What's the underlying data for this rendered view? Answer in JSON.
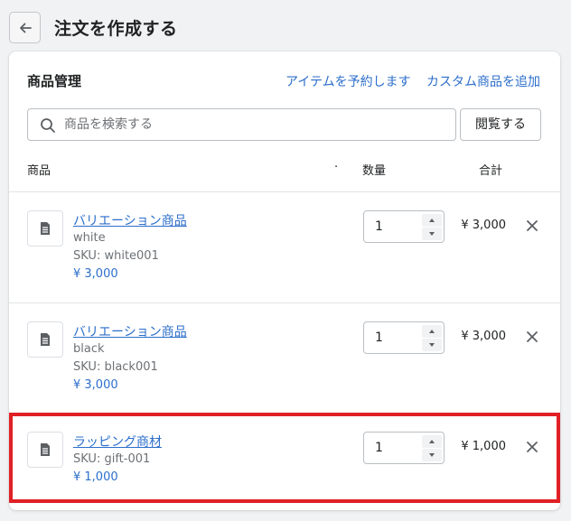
{
  "header": {
    "title": "注文を作成する"
  },
  "section": {
    "title": "商品管理",
    "reserve_link": "アイテムを予約します",
    "custom_link": "カスタム商品を追加"
  },
  "search": {
    "placeholder": "商品を検索する",
    "browse_label": "閲覧する"
  },
  "columns": {
    "product": "商品",
    "dot": "·",
    "quantity": "数量",
    "total": "合計"
  },
  "items": [
    {
      "name": "バリエーション商品",
      "variant": "white",
      "sku": "SKU: white001",
      "price": "¥ 3,000",
      "quantity": "1",
      "total": "¥ 3,000"
    },
    {
      "name": "バリエーション商品",
      "variant": "black",
      "sku": "SKU: black001",
      "price": "¥ 3,000",
      "quantity": "1",
      "total": "¥ 3,000"
    },
    {
      "name": "ラッピング商材",
      "sku": "SKU: gift-001",
      "price": "¥ 1,000",
      "quantity": "1",
      "total": "¥ 1,000"
    }
  ],
  "colors": {
    "link": "#2c6ecb",
    "highlight": "#e02025",
    "background": "#f1f2f3"
  }
}
